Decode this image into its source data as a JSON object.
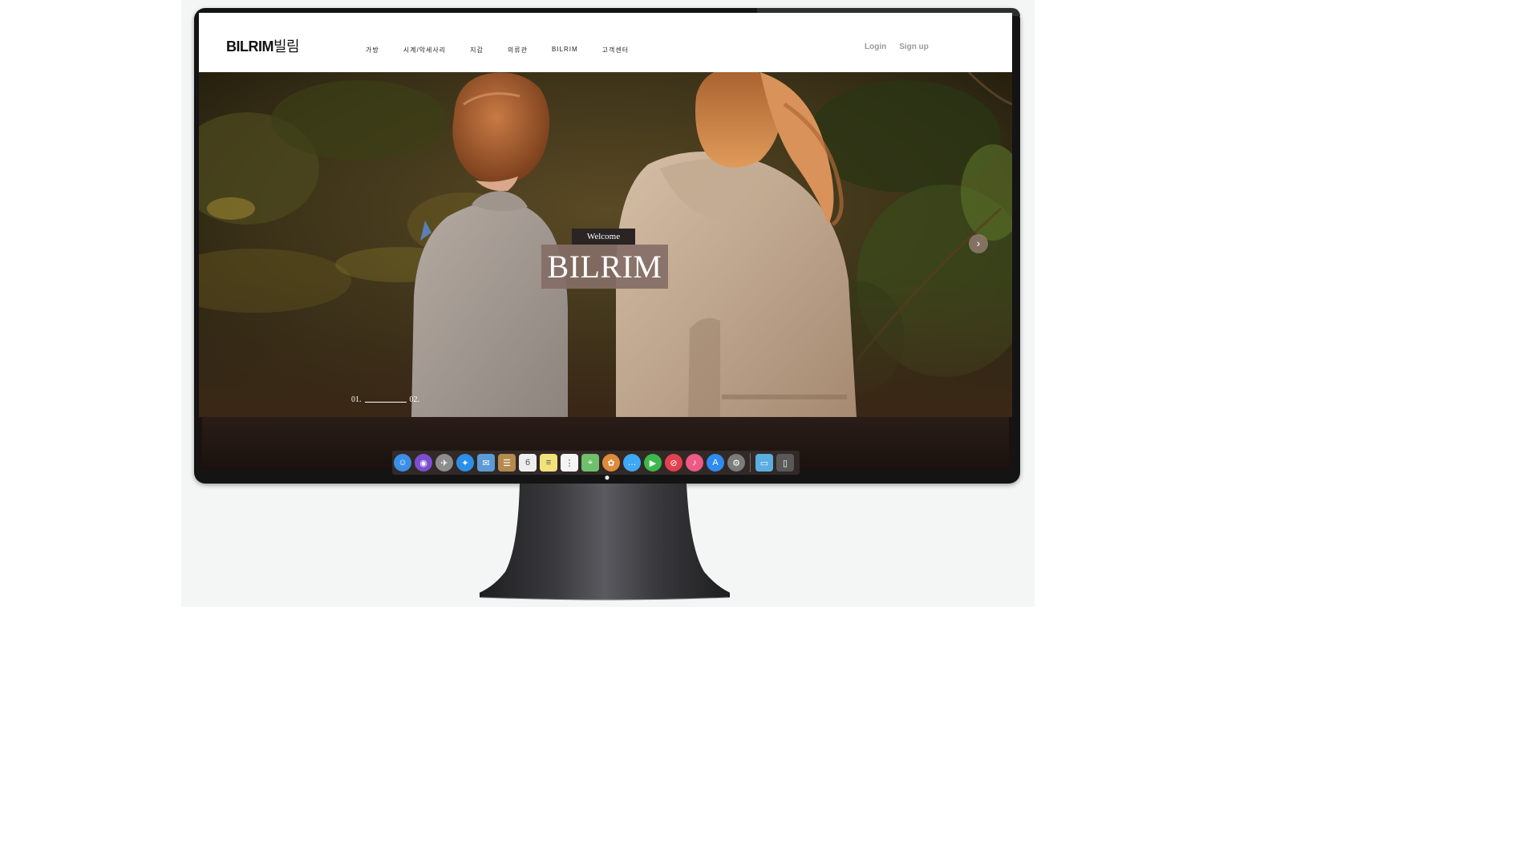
{
  "site": {
    "logo_latin": "BILRIM",
    "logo_korean": "빌림",
    "nav": [
      {
        "label": "가방"
      },
      {
        "label": "시계/악세사리"
      },
      {
        "label": "지갑"
      },
      {
        "label": "의류관"
      },
      {
        "label": "BILRIM"
      },
      {
        "label": "고객센터"
      }
    ],
    "auth": {
      "login": "Login",
      "signup": "Sign up"
    }
  },
  "hero": {
    "welcome": "Welcome",
    "title": "BILRIM",
    "next_glyph": "›",
    "pager": {
      "first": "01.",
      "second": "02."
    }
  },
  "dock": {
    "apps": [
      {
        "icon": "finder-icon",
        "color": "#3a8ee6",
        "glyph": "☺"
      },
      {
        "icon": "siri-icon",
        "color": "#7a4fd1",
        "glyph": "◉"
      },
      {
        "icon": "launchpad-icon",
        "color": "#8d8d8d",
        "glyph": "✈"
      },
      {
        "icon": "safari-icon",
        "color": "#2b8fe8",
        "glyph": "✦"
      },
      {
        "icon": "mail-icon",
        "color": "#5b9bd6",
        "glyph": "✉"
      },
      {
        "icon": "contacts-icon",
        "color": "#b58a4e",
        "glyph": "☰"
      },
      {
        "icon": "calendar-icon",
        "color": "#eeeeee",
        "glyph": "6"
      },
      {
        "icon": "notes-icon",
        "color": "#f2e27a",
        "glyph": "≡"
      },
      {
        "icon": "reminders-icon",
        "color": "#f4f4f4",
        "glyph": "⋮"
      },
      {
        "icon": "maps-icon",
        "color": "#6fbf6b",
        "glyph": "⌖"
      },
      {
        "icon": "photos-icon",
        "color": "#e08a3c",
        "glyph": "✿"
      },
      {
        "icon": "messages-icon",
        "color": "#3fa9f5",
        "glyph": "…"
      },
      {
        "icon": "facetime-icon",
        "color": "#3cb84c",
        "glyph": "▶"
      },
      {
        "icon": "news-icon",
        "color": "#e4414e",
        "glyph": "⊘"
      },
      {
        "icon": "music-icon",
        "color": "#ef5a85",
        "glyph": "♪"
      },
      {
        "icon": "app-store-icon",
        "color": "#2e8cf0",
        "glyph": "A"
      },
      {
        "icon": "system-preferences-icon",
        "color": "#7c7c7c",
        "glyph": "⚙"
      }
    ],
    "extras": [
      {
        "icon": "downloads-folder-icon",
        "color": "#5aaee0",
        "glyph": "▭"
      },
      {
        "icon": "trash-icon",
        "color": "#595959",
        "glyph": "▯"
      }
    ]
  },
  "colors": {
    "header_bg": "#ffffff",
    "title_box": "#846e66",
    "welcome_box": "#2a2423",
    "bezel": "#141414"
  }
}
